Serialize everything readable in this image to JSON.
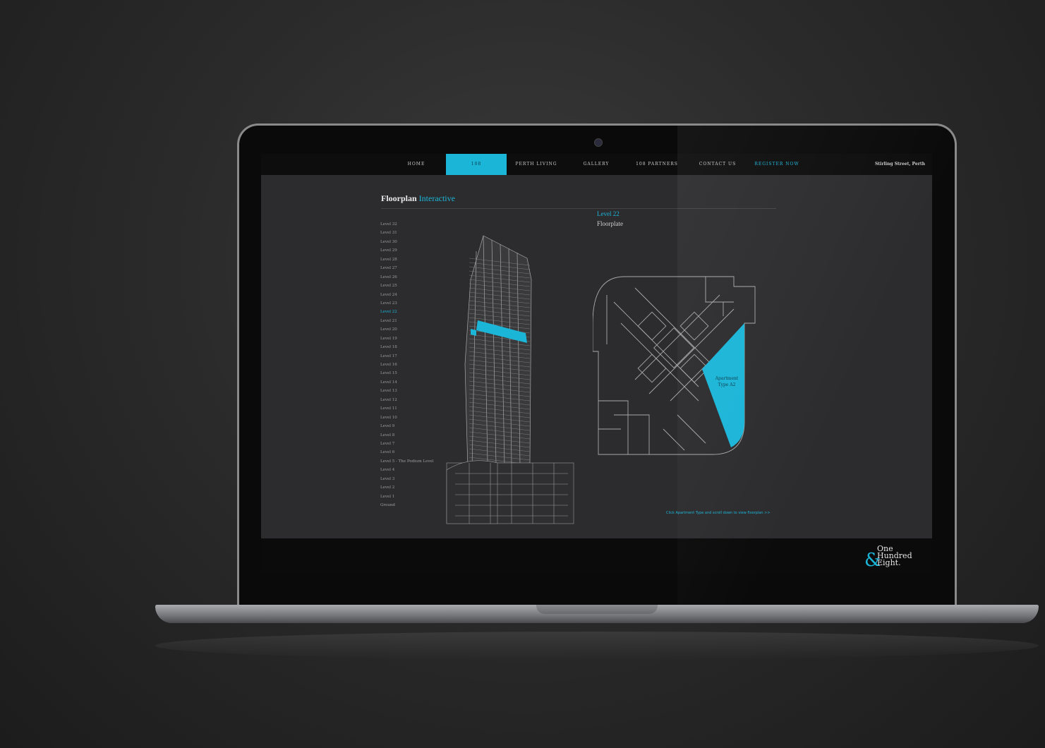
{
  "nav": {
    "items": [
      {
        "label": "Home",
        "active": false,
        "accent": false
      },
      {
        "label": "108",
        "active": true,
        "accent": false
      },
      {
        "label": "Perth Living",
        "active": false,
        "accent": false
      },
      {
        "label": "Gallery",
        "active": false,
        "accent": false
      },
      {
        "label": "108 Partners",
        "active": false,
        "accent": false
      },
      {
        "label": "Contact Us",
        "active": false,
        "accent": false
      },
      {
        "label": "Register Now",
        "active": false,
        "accent": true
      }
    ],
    "address": "Stirling Street, Perth"
  },
  "page": {
    "title": "Floorplan",
    "title_accent": "Interactive"
  },
  "levels": {
    "items": [
      "Level 32",
      "Level 31",
      "Level 30",
      "Level 29",
      "Level 28",
      "Level 27",
      "Level 26",
      "Level 25",
      "Level 24",
      "Level 23",
      "Level 22",
      "Level 21",
      "Level 20",
      "Level 19",
      "Level 18",
      "Level 17",
      "Level 16",
      "Level 15",
      "Level 14",
      "Level 13",
      "Level 12",
      "Level 11",
      "Level 10",
      "Level 9",
      "Level 8",
      "Level 7",
      "Level 6",
      "Level 5 - The Podium Level",
      "Level 4",
      "Level 3",
      "Level 2",
      "Level 1",
      "Ground"
    ],
    "selected": "Level 22"
  },
  "detail": {
    "level": "Level 22",
    "subtitle": "Floorplate",
    "apartment_line1": "Apartment",
    "apartment_line2": "Type A2",
    "bottom_link": "Click Apartment Type and scroll down to view floorplan >>"
  },
  "logo": {
    "line1": "One",
    "line2": "Hundred",
    "line3": "Eight.",
    "ampersand": "&"
  },
  "colors": {
    "accent": "#1bb5d8",
    "screen_bg": "#2c2c2e",
    "nav_bg": "#0d0d0d"
  }
}
